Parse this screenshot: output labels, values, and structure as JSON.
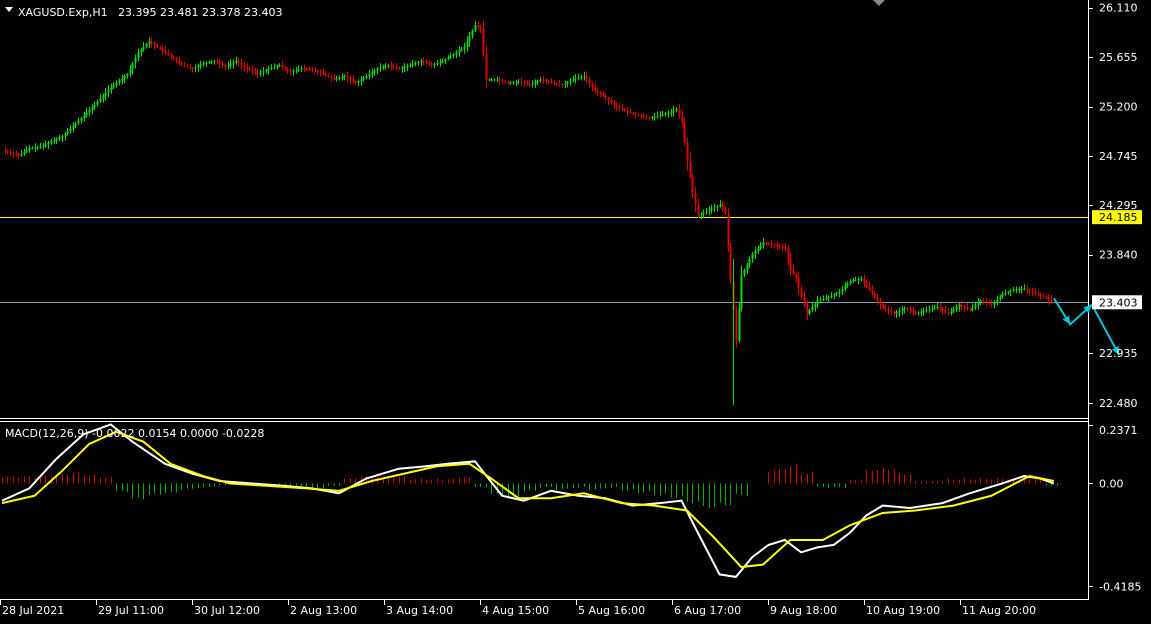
{
  "symbol_header": {
    "symbol": "XAGUSD.Exp,H1",
    "ohlc": "23.395 23.481 23.378 23.403"
  },
  "colors": {
    "background": "#000000",
    "bull": "#00e000",
    "bear": "#e00000",
    "axis": "#ffffff",
    "level_line": "#ffff00",
    "price_line": "#8a96a8",
    "macd_main": "#ffffff",
    "macd_signal": "#ffff00",
    "hist_pos": "#e00000",
    "hist_neg": "#00b000",
    "arrow": "#00c8d8"
  },
  "chart_data": [
    {
      "type": "candlestick",
      "title": "XAGUSD.Exp,H1",
      "ylim": [
        22.34,
        26.18
      ],
      "y_ticks": [
        "26.110",
        "25.655",
        "25.200",
        "24.745",
        "24.295",
        "23.840",
        "22.935",
        "22.480"
      ],
      "x_ticks": [
        "28 Jul 2021",
        "29 Jul 11:00",
        "30 Jul 12:00",
        "2 Aug 13:00",
        "3 Aug 14:00",
        "4 Aug 15:00",
        "5 Aug 16:00",
        "6 Aug 17:00",
        "9 Aug 18:00",
        "10 Aug 19:00",
        "11 Aug 20:00"
      ],
      "horizontal_levels": [
        {
          "value": 24.185,
          "label": "24.185",
          "kind": "level"
        },
        {
          "value": 23.403,
          "label": "23.403",
          "kind": "current-price"
        }
      ],
      "close_path": [
        [
          0,
          24.8
        ],
        [
          6,
          24.75
        ],
        [
          10,
          24.82
        ],
        [
          14,
          24.83
        ],
        [
          18,
          24.88
        ],
        [
          22,
          24.93
        ],
        [
          26,
          25.02
        ],
        [
          30,
          25.12
        ],
        [
          34,
          25.22
        ],
        [
          38,
          25.33
        ],
        [
          42,
          25.42
        ],
        [
          46,
          25.5
        ],
        [
          50,
          25.7
        ],
        [
          54,
          25.8
        ],
        [
          58,
          25.73
        ],
        [
          62,
          25.66
        ],
        [
          66,
          25.58
        ],
        [
          70,
          25.55
        ],
        [
          74,
          25.6
        ],
        [
          78,
          25.62
        ],
        [
          82,
          25.57
        ],
        [
          86,
          25.62
        ],
        [
          90,
          25.55
        ],
        [
          94,
          25.5
        ],
        [
          98,
          25.55
        ],
        [
          102,
          25.58
        ],
        [
          106,
          25.52
        ],
        [
          110,
          25.55
        ],
        [
          114,
          25.54
        ],
        [
          118,
          25.5
        ],
        [
          122,
          25.45
        ],
        [
          126,
          25.48
        ],
        [
          130,
          25.42
        ],
        [
          134,
          25.48
        ],
        [
          138,
          25.55
        ],
        [
          142,
          25.58
        ],
        [
          146,
          25.55
        ],
        [
          150,
          25.58
        ],
        [
          154,
          25.62
        ],
        [
          158,
          25.58
        ],
        [
          162,
          25.62
        ],
        [
          166,
          25.68
        ],
        [
          170,
          25.75
        ],
        [
          174,
          25.95
        ],
        [
          176,
          25.92
        ],
        [
          178,
          25.45
        ],
        [
          182,
          25.45
        ],
        [
          186,
          25.42
        ],
        [
          190,
          25.43
        ],
        [
          194,
          25.4
        ],
        [
          198,
          25.45
        ],
        [
          202,
          25.42
        ],
        [
          206,
          25.4
        ],
        [
          210,
          25.45
        ],
        [
          214,
          25.48
        ],
        [
          218,
          25.35
        ],
        [
          222,
          25.28
        ],
        [
          226,
          25.2
        ],
        [
          230,
          25.15
        ],
        [
          234,
          25.12
        ],
        [
          238,
          25.1
        ],
        [
          242,
          25.12
        ],
        [
          246,
          25.15
        ],
        [
          248,
          25.18
        ],
        [
          250,
          25.05
        ],
        [
          252,
          24.7
        ],
        [
          254,
          24.4
        ],
        [
          256,
          24.2
        ],
        [
          260,
          24.25
        ],
        [
          264,
          24.3
        ],
        [
          266,
          24.22
        ],
        [
          268,
          23.6
        ],
        [
          270,
          23.05
        ],
        [
          272,
          23.65
        ],
        [
          276,
          23.85
        ],
        [
          280,
          23.95
        ],
        [
          284,
          23.93
        ],
        [
          288,
          23.9
        ],
        [
          290,
          23.7
        ],
        [
          292,
          23.62
        ],
        [
          294,
          23.45
        ],
        [
          296,
          23.3
        ],
        [
          300,
          23.42
        ],
        [
          304,
          23.45
        ],
        [
          308,
          23.5
        ],
        [
          312,
          23.6
        ],
        [
          316,
          23.62
        ],
        [
          320,
          23.48
        ],
        [
          324,
          23.35
        ],
        [
          328,
          23.3
        ],
        [
          332,
          23.35
        ],
        [
          336,
          23.3
        ],
        [
          340,
          23.33
        ],
        [
          344,
          23.36
        ],
        [
          348,
          23.3
        ],
        [
          352,
          23.38
        ],
        [
          356,
          23.33
        ],
        [
          360,
          23.42
        ],
        [
          364,
          23.38
        ],
        [
          368,
          23.48
        ],
        [
          372,
          23.52
        ],
        [
          376,
          23.53
        ],
        [
          380,
          23.48
        ],
        [
          384,
          23.45
        ],
        [
          386,
          23.4
        ]
      ],
      "forecast_arrow": [
        [
          387,
          23.44
        ],
        [
          393,
          23.2
        ],
        [
          401,
          23.38
        ],
        [
          411,
          22.92
        ]
      ]
    },
    {
      "type": "line",
      "title": "MACD(12,26,9) -0.0022 0.0154 0.0000 -0.0228",
      "ylim": [
        -0.47,
        0.25
      ],
      "y_ticks": [
        "0.2371",
        "0.00",
        "-0.4185"
      ],
      "series": [
        {
          "name": "main",
          "points": [
            [
              0,
              -0.07
            ],
            [
              10,
              -0.02
            ],
            [
              20,
              0.1
            ],
            [
              30,
              0.2
            ],
            [
              40,
              0.24
            ],
            [
              48,
              0.17
            ],
            [
              60,
              0.08
            ],
            [
              70,
              0.04
            ],
            [
              80,
              0.01
            ],
            [
              92,
              0.0
            ],
            [
              104,
              -0.01
            ],
            [
              114,
              -0.02
            ],
            [
              124,
              -0.04
            ],
            [
              134,
              0.02
            ],
            [
              146,
              0.06
            ],
            [
              156,
              0.07
            ],
            [
              164,
              0.08
            ],
            [
              174,
              0.09
            ],
            [
              184,
              -0.05
            ],
            [
              192,
              -0.07
            ],
            [
              202,
              -0.03
            ],
            [
              212,
              -0.05
            ],
            [
              222,
              -0.06
            ],
            [
              232,
              -0.09
            ],
            [
              242,
              -0.08
            ],
            [
              250,
              -0.07
            ],
            [
              256,
              -0.2
            ],
            [
              264,
              -0.37
            ],
            [
              270,
              -0.38
            ],
            [
              276,
              -0.3
            ],
            [
              282,
              -0.25
            ],
            [
              288,
              -0.23
            ],
            [
              294,
              -0.28
            ],
            [
              300,
              -0.26
            ],
            [
              306,
              -0.25
            ],
            [
              312,
              -0.2
            ],
            [
              318,
              -0.13
            ],
            [
              324,
              -0.09
            ],
            [
              334,
              -0.1
            ],
            [
              346,
              -0.08
            ],
            [
              356,
              -0.04
            ],
            [
              368,
              0.0
            ],
            [
              376,
              0.03
            ],
            [
              382,
              0.02
            ],
            [
              387,
              0.0
            ]
          ]
        },
        {
          "name": "signal",
          "points": [
            [
              0,
              -0.08
            ],
            [
              12,
              -0.05
            ],
            [
              22,
              0.05
            ],
            [
              32,
              0.16
            ],
            [
              42,
              0.21
            ],
            [
              52,
              0.17
            ],
            [
              62,
              0.08
            ],
            [
              74,
              0.03
            ],
            [
              84,
              0.0
            ],
            [
              98,
              -0.01
            ],
            [
              112,
              -0.02
            ],
            [
              124,
              -0.03
            ],
            [
              136,
              0.01
            ],
            [
              148,
              0.04
            ],
            [
              160,
              0.07
            ],
            [
              172,
              0.08
            ],
            [
              180,
              0.02
            ],
            [
              190,
              -0.06
            ],
            [
              202,
              -0.06
            ],
            [
              214,
              -0.04
            ],
            [
              228,
              -0.08
            ],
            [
              240,
              -0.09
            ],
            [
              252,
              -0.11
            ],
            [
              262,
              -0.22
            ],
            [
              272,
              -0.34
            ],
            [
              280,
              -0.33
            ],
            [
              290,
              -0.23
            ],
            [
              302,
              -0.23
            ],
            [
              312,
              -0.17
            ],
            [
              324,
              -0.12
            ],
            [
              336,
              -0.11
            ],
            [
              350,
              -0.09
            ],
            [
              364,
              -0.05
            ],
            [
              378,
              0.03
            ],
            [
              387,
              0.01
            ]
          ]
        }
      ],
      "histogram": [
        [
          0,
          0.03
        ],
        [
          6,
          0.03
        ],
        [
          12,
          0.03
        ],
        [
          18,
          0.04
        ],
        [
          24,
          0.05
        ],
        [
          30,
          0.04
        ],
        [
          36,
          0.03
        ],
        [
          42,
          -0.04
        ],
        [
          48,
          -0.08
        ],
        [
          54,
          -0.06
        ],
        [
          60,
          -0.05
        ],
        [
          66,
          -0.03
        ],
        [
          72,
          -0.02
        ],
        [
          78,
          -0.01
        ],
        [
          84,
          0.0
        ],
        [
          90,
          0.0
        ],
        [
          96,
          -0.01
        ],
        [
          102,
          -0.01
        ],
        [
          108,
          -0.02
        ],
        [
          114,
          -0.02
        ],
        [
          120,
          -0.01
        ],
        [
          126,
          0.02
        ],
        [
          132,
          0.03
        ],
        [
          138,
          0.03
        ],
        [
          144,
          0.03
        ],
        [
          150,
          0.02
        ],
        [
          156,
          0.02
        ],
        [
          162,
          0.02
        ],
        [
          168,
          0.03
        ],
        [
          174,
          -0.02
        ],
        [
          180,
          -0.06
        ],
        [
          186,
          -0.08
        ],
        [
          192,
          -0.04
        ],
        [
          198,
          -0.02
        ],
        [
          204,
          -0.03
        ],
        [
          210,
          -0.02
        ],
        [
          216,
          -0.03
        ],
        [
          222,
          -0.02
        ],
        [
          228,
          -0.03
        ],
        [
          234,
          -0.04
        ],
        [
          240,
          -0.05
        ],
        [
          246,
          -0.06
        ],
        [
          252,
          -0.08
        ],
        [
          258,
          -0.1
        ],
        [
          264,
          -0.09
        ],
        [
          270,
          -0.05
        ],
        [
          276,
          0.0
        ],
        [
          282,
          0.06
        ],
        [
          288,
          0.08
        ],
        [
          294,
          0.05
        ],
        [
          300,
          -0.02
        ],
        [
          306,
          -0.02
        ],
        [
          312,
          0.02
        ],
        [
          318,
          0.07
        ],
        [
          324,
          0.08
        ],
        [
          330,
          0.05
        ],
        [
          336,
          0.01
        ],
        [
          342,
          0.01
        ],
        [
          348,
          0.02
        ],
        [
          354,
          0.02
        ],
        [
          360,
          0.02
        ],
        [
          366,
          0.02
        ],
        [
          372,
          0.02
        ],
        [
          378,
          0.02
        ],
        [
          384,
          -0.01
        ]
      ]
    }
  ]
}
